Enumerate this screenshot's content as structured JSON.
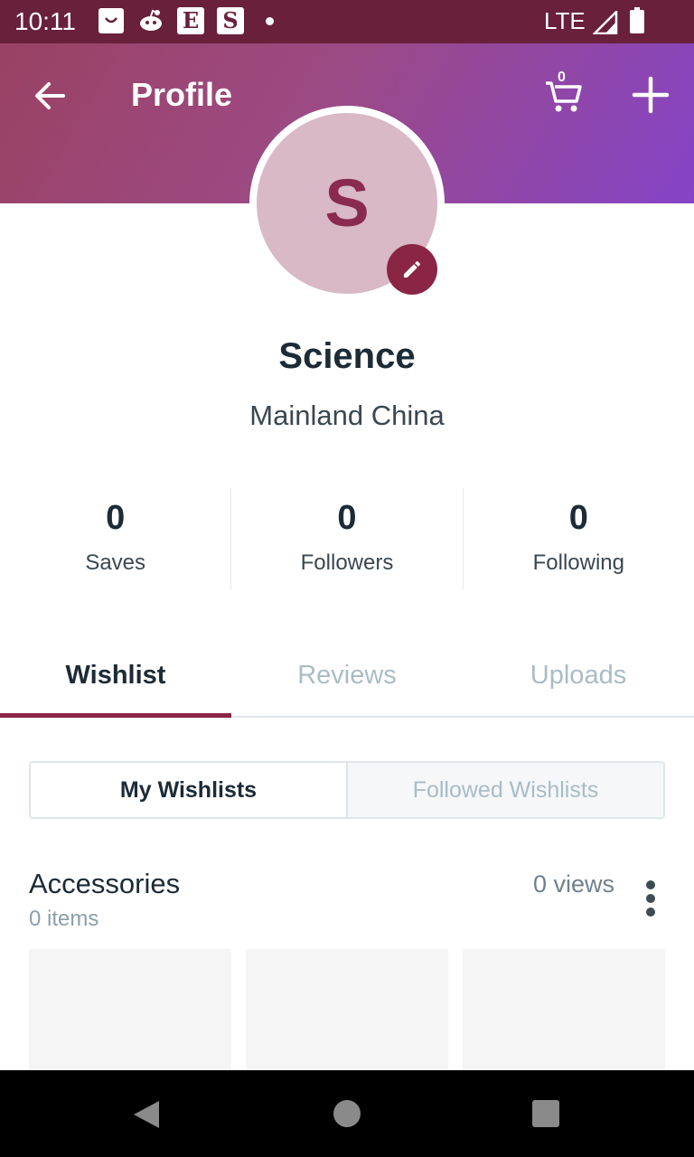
{
  "status_bar": {
    "time": "10:11",
    "network": "LTE",
    "notification_icons": [
      "shopping-bag-icon",
      "reddit-icon",
      "etsy-icon",
      "s-app-icon"
    ],
    "etsy_letter": "E",
    "s_letter": "S",
    "background": "#68203b"
  },
  "header": {
    "title": "Profile",
    "cart_count": "0",
    "gradient": [
      "#9a4263",
      "#8544c7"
    ]
  },
  "profile": {
    "avatar_initial": "S",
    "name": "Science",
    "location": "Mainland China",
    "accent": "#8a2546"
  },
  "stats": [
    {
      "value": "0",
      "label": "Saves"
    },
    {
      "value": "0",
      "label": "Followers"
    },
    {
      "value": "0",
      "label": "Following"
    }
  ],
  "tabs": [
    {
      "label": "Wishlist",
      "active": true
    },
    {
      "label": "Reviews",
      "active": false
    },
    {
      "label": "Uploads",
      "active": false
    }
  ],
  "segments": {
    "my": "My Wishlists",
    "followed": "Followed Wishlists"
  },
  "wishlist": {
    "title": "Accessories",
    "items": "0 items",
    "views": "0 views"
  }
}
